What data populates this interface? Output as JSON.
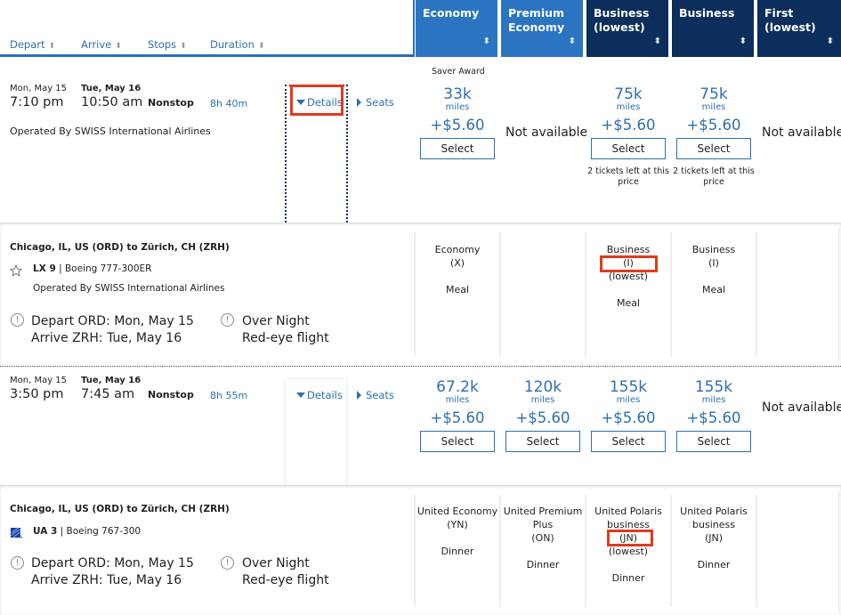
{
  "header": {
    "sort_columns": [
      {
        "label": "Depart"
      },
      {
        "label": "Arrive"
      },
      {
        "label": "Stops"
      },
      {
        "label": "Duration"
      }
    ],
    "cabin_columns": [
      {
        "line1": "Economy",
        "line2": ""
      },
      {
        "line1": "Premium",
        "line2": "Economy"
      },
      {
        "line1": "Business",
        "line2": "(lowest)"
      },
      {
        "line1": "Business",
        "line2": ""
      },
      {
        "line1": "First",
        "line2": "(lowest)"
      }
    ],
    "sort_icon": "↕"
  },
  "flights": [
    {
      "depart_date": "Mon, May 15",
      "depart_time": "7:10 pm",
      "arrive_date": "Tue, May 16",
      "arrive_time": "10:50 am",
      "stops": "Nonstop",
      "duration": "8h 40m",
      "operated_by": "Operated By SWISS International Airlines",
      "details_label": "Details",
      "seats_label": "Seats",
      "saver_label": "Saver Award",
      "fares": [
        {
          "miles": "33k",
          "miles_unit": "miles",
          "tax": "+$5.60",
          "select": "Select",
          "note": ""
        },
        {
          "not_available": "Not available"
        },
        {
          "miles": "75k",
          "miles_unit": "miles",
          "tax": "+$5.60",
          "select": "Select",
          "note": "2 tickets left at this price"
        },
        {
          "miles": "75k",
          "miles_unit": "miles",
          "tax": "+$5.60",
          "select": "Select",
          "note": "2 tickets left at this price"
        },
        {
          "not_available": "Not available"
        }
      ],
      "details": {
        "route": "Chicago, IL, US (ORD) to Zürich, CH (ZRH)",
        "flight_number": "LX 9",
        "aircraft": "Boeing 777-300ER",
        "operated_by": "Operated By SWISS International Airlines",
        "airline_icon": "star-alliance-icon",
        "depart_info": "Depart ORD: Mon, May 15",
        "arrive_info": "Arrive ZRH: Tue, May 16",
        "overnight_title": "Over Night",
        "overnight_sub": "Red-eye flight",
        "cabins": [
          {
            "lines": [
              "Economy",
              "(X)",
              "",
              "Meal"
            ]
          },
          {
            "lines": []
          },
          {
            "lines": [
              "Business",
              "(I)",
              "(lowest)",
              "",
              "Meal"
            ]
          },
          {
            "lines": [
              "Business",
              "(I)",
              "",
              "Meal"
            ]
          },
          {
            "lines": []
          }
        ]
      }
    },
    {
      "depart_date": "Mon, May 15",
      "depart_time": "3:50 pm",
      "arrive_date": "Tue, May 16",
      "arrive_time": "7:45 am",
      "stops": "Nonstop",
      "duration": "8h 55m",
      "details_label": "Details",
      "seats_label": "Seats",
      "fares": [
        {
          "miles": "67.2k",
          "miles_unit": "miles",
          "tax": "+$5.60",
          "select": "Select"
        },
        {
          "miles": "120k",
          "miles_unit": "miles",
          "tax": "+$5.60",
          "select": "Select"
        },
        {
          "miles": "155k",
          "miles_unit": "miles",
          "tax": "+$5.60",
          "select": "Select"
        },
        {
          "miles": "155k",
          "miles_unit": "miles",
          "tax": "+$5.60",
          "select": "Select"
        },
        {
          "not_available": "Not available"
        }
      ],
      "details": {
        "route": "Chicago, IL, US (ORD) to Zürich, CH (ZRH)",
        "flight_number": "UA 3",
        "aircraft": "Boeing 767-300",
        "airline_icon": "united-globe-icon",
        "depart_info": "Depart ORD: Mon, May 15",
        "arrive_info": "Arrive ZRH: Tue, May 16",
        "overnight_title": "Over Night",
        "overnight_sub": "Red-eye flight",
        "cabins": [
          {
            "lines": [
              "United Economy",
              "(YN)",
              "",
              "Dinner"
            ]
          },
          {
            "lines": [
              "United Premium",
              "Plus",
              "(ON)",
              "",
              "Dinner"
            ]
          },
          {
            "lines": [
              "United Polaris",
              "business",
              "(JN)",
              "(lowest)",
              "",
              "Dinner"
            ]
          },
          {
            "lines": [
              "United Polaris",
              "business",
              "(JN)",
              "",
              "Dinner"
            ]
          },
          {
            "lines": []
          }
        ]
      }
    }
  ],
  "colors": {
    "header_light": "#2a74c2",
    "header_dark": "#0b2e5c",
    "link": "#2e6fb0",
    "highlight": "#e03a1e"
  }
}
